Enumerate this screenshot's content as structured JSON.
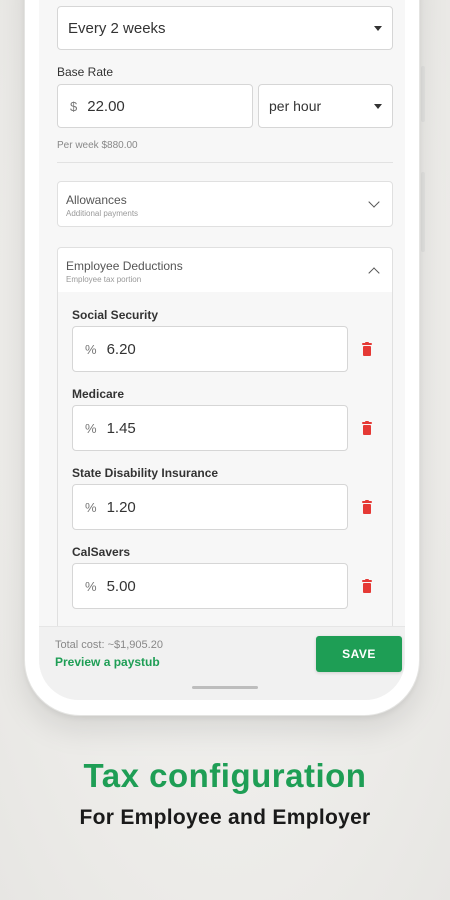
{
  "pay_frequency": {
    "value": "Every 2 weeks"
  },
  "base_rate": {
    "label": "Base Rate",
    "currency_prefix": "$",
    "amount": "22.00",
    "unit": "per hour",
    "per_week_hint": "Per week $880.00"
  },
  "allowances": {
    "title": "Allowances",
    "subtitle": "Additional payments"
  },
  "employee_deductions": {
    "title": "Employee Deductions",
    "subtitle": "Employee tax portion",
    "items": [
      {
        "label": "Social Security",
        "prefix": "%",
        "value": "6.20"
      },
      {
        "label": "Medicare",
        "prefix": "%",
        "value": "1.45"
      },
      {
        "label": "State Disability Insurance",
        "prefix": "%",
        "value": "1.20"
      },
      {
        "label": "CalSavers",
        "prefix": "%",
        "value": "5.00"
      }
    ]
  },
  "footer": {
    "total_cost": "Total cost: ~$1,905.20",
    "preview_link": "Preview a paystub",
    "save_label": "SAVE"
  },
  "promo": {
    "headline": "Tax configuration",
    "subline": "For Employee and Employer"
  },
  "colors": {
    "accent_green": "#1e9e55",
    "delete_red": "#e53935",
    "background": "#eeeeec"
  },
  "icons": [
    "caret-down-icon",
    "chevron-down-icon",
    "chevron-up-icon",
    "trash-icon"
  ]
}
